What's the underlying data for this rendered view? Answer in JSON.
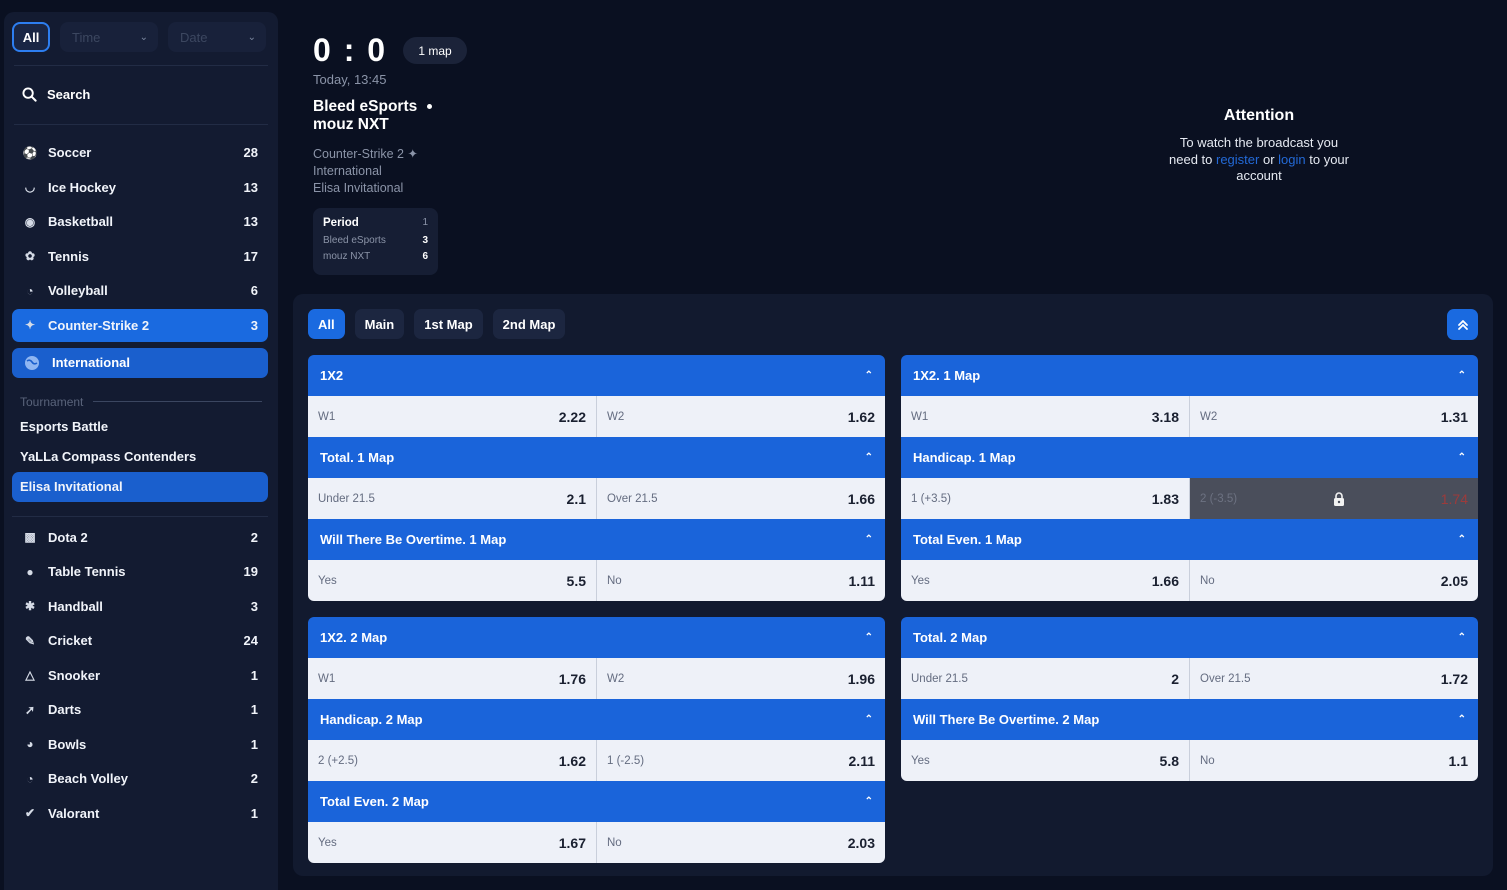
{
  "sidebar": {
    "filters": {
      "all": "All",
      "time": "Time",
      "date": "Date"
    },
    "search": "Search",
    "sports_top": [
      {
        "name": "Soccer",
        "count": "28",
        "icon": "soccer-icon"
      },
      {
        "name": "Ice Hockey",
        "count": "13",
        "icon": "ice-hockey-icon"
      },
      {
        "name": "Basketball",
        "count": "13",
        "icon": "basketball-icon"
      },
      {
        "name": "Tennis",
        "count": "17",
        "icon": "tennis-icon"
      },
      {
        "name": "Volleyball",
        "count": "6",
        "icon": "volleyball-icon"
      },
      {
        "name": "Counter-Strike 2",
        "count": "3",
        "icon": "counter-strike-icon"
      }
    ],
    "region": "International",
    "tournament_label": "Tournament",
    "tournaments": [
      "Esports Battle",
      "YaLLa Compass Contenders",
      "Elisa Invitational"
    ],
    "sports_bottom": [
      {
        "name": "Dota 2",
        "count": "2",
        "icon": "dota-icon"
      },
      {
        "name": "Table Tennis",
        "count": "19",
        "icon": "table-tennis-icon"
      },
      {
        "name": "Handball",
        "count": "3",
        "icon": "handball-icon"
      },
      {
        "name": "Cricket",
        "count": "24",
        "icon": "cricket-icon"
      },
      {
        "name": "Snooker",
        "count": "1",
        "icon": "snooker-icon"
      },
      {
        "name": "Darts",
        "count": "1",
        "icon": "darts-icon"
      },
      {
        "name": "Bowls",
        "count": "1",
        "icon": "bowls-icon"
      },
      {
        "name": "Beach Volley",
        "count": "2",
        "icon": "beach-volley-icon"
      },
      {
        "name": "Valorant",
        "count": "1",
        "icon": "valorant-icon"
      }
    ]
  },
  "match": {
    "score": "0 : 0",
    "map_badge": "1 map",
    "when": "Today, 13:45",
    "team1": "Bleed eSports",
    "team2": "mouz NXT",
    "game": "Counter-Strike 2",
    "region": "International",
    "tournament": "Elisa Invitational",
    "period": {
      "label": "Period",
      "number": "1",
      "team1": "Bleed eSports",
      "team1_score": "3",
      "team2": "mouz NXT",
      "team2_score": "6"
    }
  },
  "attention": {
    "title": "Attention",
    "line1": "To watch the broadcast you",
    "pre": "need to ",
    "register": "register",
    "or": " or ",
    "login": "login",
    "post": " to your",
    "line3": "account"
  },
  "tabs": [
    "All",
    "Main",
    "1st Map",
    "2nd Map"
  ],
  "markets": {
    "left_top": [
      {
        "title": "1X2",
        "odds": [
          [
            "W1",
            "2.22"
          ],
          [
            "W2",
            "1.62"
          ]
        ]
      },
      {
        "title": "Total. 1 Map",
        "odds": [
          [
            "Under 21.5",
            "2.1"
          ],
          [
            "Over 21.5",
            "1.66"
          ]
        ]
      },
      {
        "title": "Will There Be Overtime. 1 Map",
        "odds": [
          [
            "Yes",
            "5.5"
          ],
          [
            "No",
            "1.11"
          ]
        ]
      }
    ],
    "right_top": [
      {
        "title": "1X2. 1 Map",
        "odds": [
          [
            "W1",
            "3.18"
          ],
          [
            "W2",
            "1.31"
          ]
        ]
      },
      {
        "title": "Handicap. 1 Map",
        "odds": [
          [
            "1 (+3.5)",
            "1.83"
          ],
          [
            "2 (-3.5)",
            "1.74"
          ]
        ]
      },
      {
        "title": "Total Even. 1 Map",
        "odds": [
          [
            "Yes",
            "1.66"
          ],
          [
            "No",
            "2.05"
          ]
        ]
      }
    ],
    "left_bottom": [
      {
        "title": "1X2. 2 Map",
        "odds": [
          [
            "W1",
            "1.76"
          ],
          [
            "W2",
            "1.96"
          ]
        ]
      },
      {
        "title": "Handicap. 2 Map",
        "odds": [
          [
            "2 (+2.5)",
            "1.62"
          ],
          [
            "1 (-2.5)",
            "2.11"
          ]
        ]
      },
      {
        "title": "Total Even. 2 Map",
        "odds": [
          [
            "Yes",
            "1.67"
          ],
          [
            "No",
            "2.03"
          ]
        ]
      }
    ],
    "right_bottom": [
      {
        "title": "Total. 2 Map",
        "odds": [
          [
            "Under 21.5",
            "2"
          ],
          [
            "Over 21.5",
            "1.72"
          ]
        ]
      },
      {
        "title": "Will There Be Overtime. 2 Map",
        "odds": [
          [
            "Yes",
            "5.8"
          ],
          [
            "No",
            "1.1"
          ]
        ]
      }
    ]
  }
}
